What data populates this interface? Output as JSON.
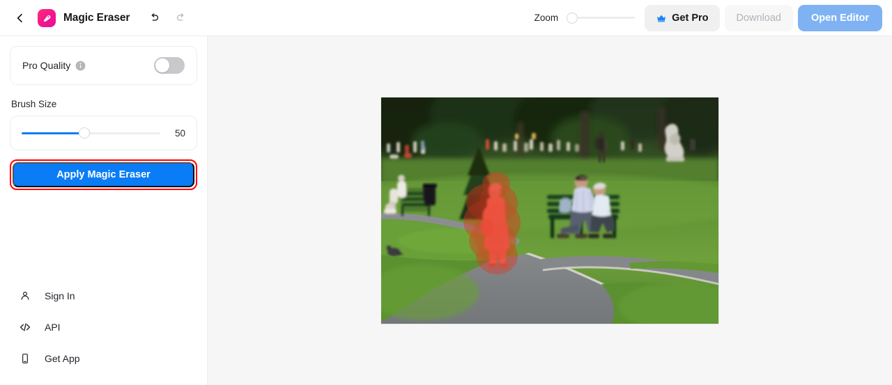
{
  "header": {
    "back_icon": "chevron-left-icon",
    "logo_icon": "magic-eraser-logo-icon",
    "app_title": "Magic Eraser",
    "undo_icon": "undo-icon",
    "redo_icon": "redo-icon",
    "zoom_label": "Zoom",
    "zoom_value": 0,
    "get_pro_label": "Get Pro",
    "get_pro_icon": "crown-icon",
    "download_label": "Download",
    "download_enabled": false,
    "open_editor_label": "Open Editor"
  },
  "sidebar": {
    "pro_quality": {
      "label": "Pro Quality",
      "info_icon": "info-icon",
      "toggle_state": "off"
    },
    "brush_size": {
      "label": "Brush Size",
      "value": "50",
      "fill_percent": 45
    },
    "apply_button": {
      "label": "Apply Magic Eraser",
      "highlighted": true
    },
    "links": [
      {
        "label": "Sign In",
        "icon": "user-icon"
      },
      {
        "label": "API",
        "icon": "code-icon"
      },
      {
        "label": "Get App",
        "icon": "phone-icon"
      }
    ]
  },
  "canvas": {
    "image_alt": "Park scene with people on benches and a path",
    "mask_color": "#e8301c",
    "mask_label": "brush-mask-overlay"
  },
  "colors": {
    "accent_blue": "#0a7cf6",
    "open_editor_blue": "#7fb2f3",
    "brand_pink": "#f2158f",
    "highlight_red": "#ff0000",
    "canvas_bg": "#f6f6f6"
  }
}
